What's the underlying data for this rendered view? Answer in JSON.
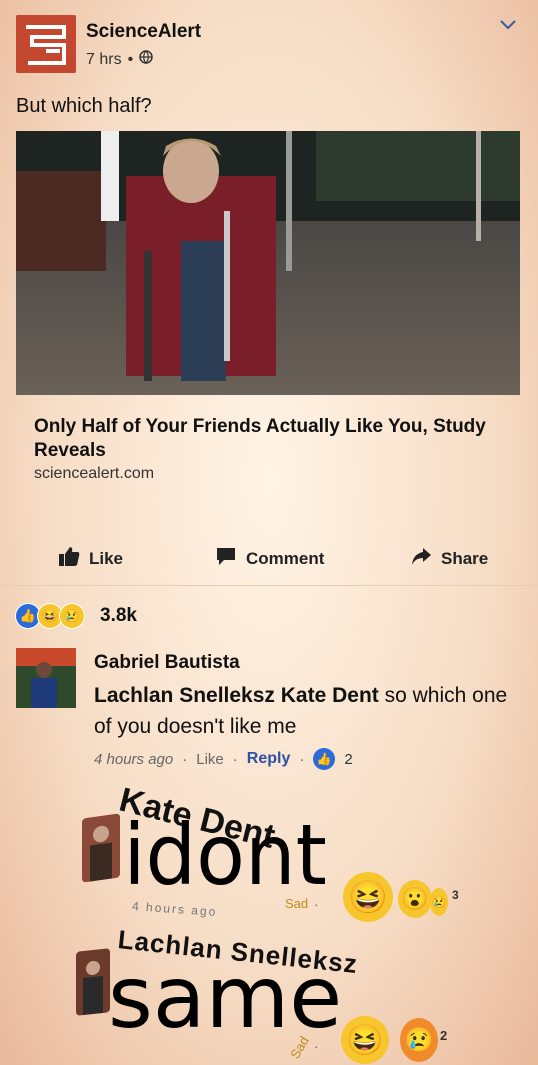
{
  "post": {
    "page_name": "ScienceAlert",
    "time": "7 hrs",
    "dot": "•",
    "text": "But which half?"
  },
  "link": {
    "title": "Only Half of Your Friends Actually Like You, Study Reveals",
    "domain": "sciencealert.com"
  },
  "actions": {
    "like": "Like",
    "comment": "Comment",
    "share": "Share"
  },
  "reactions": {
    "count": "3.8k"
  },
  "comment": {
    "author": "Gabriel Bautista",
    "mention1": "Lachlan Snelleksz Kate Dent",
    "text": "so which one of you doesn't like me",
    "time": "4 hours ago",
    "sep": "·",
    "like": "Like",
    "reply": "Reply",
    "like_count": "2"
  },
  "replies": [
    {
      "author": "Kate Dent",
      "text": "idont",
      "time": "4 hours ago",
      "reaction": "Sad",
      "react_count": "3"
    },
    {
      "author": "Lachlan Snelleksz",
      "text": "same",
      "reaction": "Sad",
      "react_count": "2"
    }
  ],
  "colors": {
    "brand": "#c4482f",
    "like_blue": "#2b6bd9",
    "link_blue": "#2d50a8"
  }
}
